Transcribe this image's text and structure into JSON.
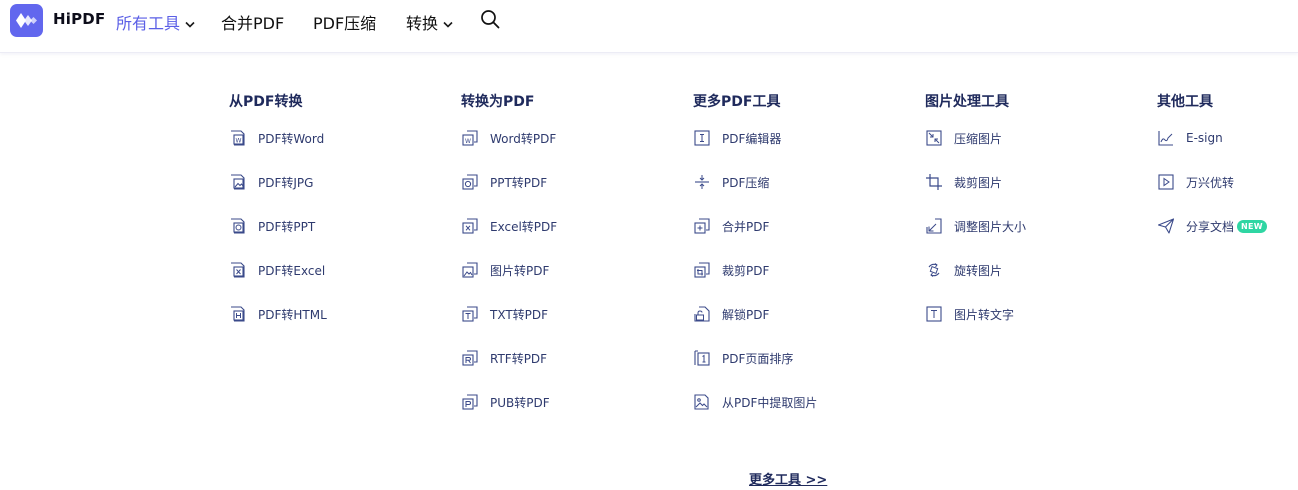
{
  "brand": {
    "name": "HiPDF",
    "accent": "#6267ee"
  },
  "nav": {
    "all_tools": "所有工具",
    "merge": "合并PDF",
    "compress": "PDF压缩",
    "convert": "转换",
    "active_color": "#5b5fe6"
  },
  "columns": [
    {
      "title": "从PDF转换",
      "items": [
        {
          "label": "PDF转Word",
          "icon": "file-word-icon"
        },
        {
          "label": "PDF转JPG",
          "icon": "file-image-icon"
        },
        {
          "label": "PDF转PPT",
          "icon": "file-ppt-icon"
        },
        {
          "label": "PDF转Excel",
          "icon": "file-excel-icon"
        },
        {
          "label": "PDF转HTML",
          "icon": "file-html-icon"
        }
      ]
    },
    {
      "title": "转换为PDF",
      "items": [
        {
          "label": "Word转PDF",
          "icon": "word-to-pdf-icon"
        },
        {
          "label": "PPT转PDF",
          "icon": "ppt-to-pdf-icon"
        },
        {
          "label": "Excel转PDF",
          "icon": "excel-to-pdf-icon"
        },
        {
          "label": "图片转PDF",
          "icon": "image-to-pdf-icon"
        },
        {
          "label": "TXT转PDF",
          "icon": "txt-to-pdf-icon"
        },
        {
          "label": "RTF转PDF",
          "icon": "rtf-to-pdf-icon"
        },
        {
          "label": "PUB转PDF",
          "icon": "pub-to-pdf-icon"
        }
      ]
    },
    {
      "title": "更多PDF工具",
      "items": [
        {
          "label": "PDF编辑器",
          "icon": "text-cursor-icon"
        },
        {
          "label": "PDF压缩",
          "icon": "compress-icon"
        },
        {
          "label": "合并PDF",
          "icon": "merge-icon"
        },
        {
          "label": "裁剪PDF",
          "icon": "crop-pdf-icon"
        },
        {
          "label": "解锁PDF",
          "icon": "unlock-icon"
        },
        {
          "label": "PDF页面排序",
          "icon": "page-order-icon"
        },
        {
          "label": "从PDF中提取图片",
          "icon": "extract-image-icon"
        }
      ]
    },
    {
      "title": "图片处理工具",
      "items": [
        {
          "label": "压缩图片",
          "icon": "compress-image-icon"
        },
        {
          "label": "裁剪图片",
          "icon": "crop-icon"
        },
        {
          "label": "调整图片大小",
          "icon": "resize-icon"
        },
        {
          "label": "旋转图片",
          "icon": "rotate-icon"
        },
        {
          "label": "图片转文字",
          "icon": "ocr-text-icon"
        }
      ]
    },
    {
      "title": "其他工具",
      "items": [
        {
          "label": "E-sign",
          "icon": "esign-icon"
        },
        {
          "label": "万兴优转",
          "icon": "play-icon"
        },
        {
          "label": "分享文档",
          "icon": "send-icon",
          "badge": "NEW"
        }
      ]
    }
  ],
  "badge_color": "#2fd6a3",
  "more_tools": "更多工具 >>"
}
